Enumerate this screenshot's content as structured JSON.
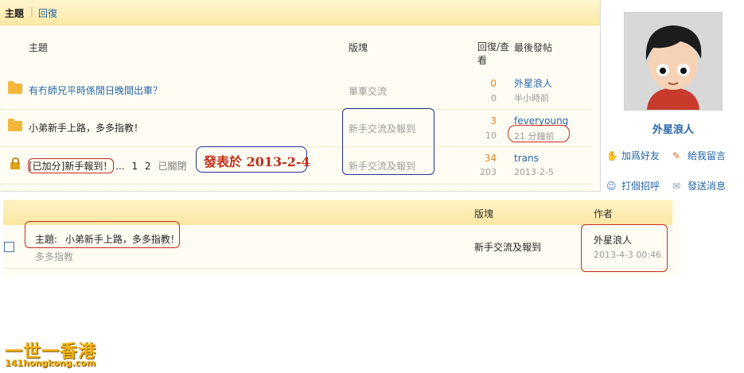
{
  "tabs": {
    "topics": "主題",
    "separator": "|",
    "replies": "回復"
  },
  "topic_list": {
    "headers": {
      "topic": "主題",
      "board": "版塊",
      "reply_view": "回復/查看",
      "last_post": "最後發帖"
    },
    "rows": [
      {
        "title": "有冇師兄平時係閒日晚間出車？",
        "board": "單車交流",
        "replies": "0",
        "views": "0",
        "last_user": "外星浪人",
        "last_time": "半小時前"
      },
      {
        "title": "小弟新手上路，多多指教！",
        "board": "新手交流及報到",
        "replies": "3",
        "views": "10",
        "last_user": "feveryoung",
        "last_time": "21 分鐘前"
      },
      {
        "title_prefix": "[已加分]",
        "title": "新手報到！",
        "pages": [
          "...",
          "1",
          "2"
        ],
        "status": "已關閉",
        "board": "新手交流及報到",
        "replies": "34",
        "views": "203",
        "last_user": "trans",
        "last_time": "2013-2-5"
      }
    ]
  },
  "profile": {
    "name": "外星浪人",
    "actions": {
      "add_friend": "加爲好友",
      "leave_message": "給我留言",
      "greet": "打個招呼",
      "send_message": "發送消息"
    }
  },
  "posts": {
    "headers": {
      "board": "版塊",
      "author": "作者"
    },
    "row": {
      "title_label": "主題:",
      "title": "小弟新手上路，多多指教！",
      "excerpt": "多多指教",
      "board": "新手交流及報到",
      "author": "外星浪人",
      "time": "2013-4-3 00:46"
    }
  },
  "annotation": {
    "posted_on": "發表於 2013-2-4"
  },
  "watermark": {
    "line1": "一世一香港",
    "line2": "141hongkong.com"
  },
  "colors": {
    "link": "#2566a8",
    "header_bg": "#fce9a6",
    "annotation_red": "#c62a22",
    "annotation_blue": "#23319a",
    "watermark": "#f3b416"
  },
  "icons": [
    "folder-icon",
    "lock-icon",
    "handshake-icon",
    "pencil-icon",
    "greet-icon",
    "envelope-icon",
    "checkbox"
  ]
}
